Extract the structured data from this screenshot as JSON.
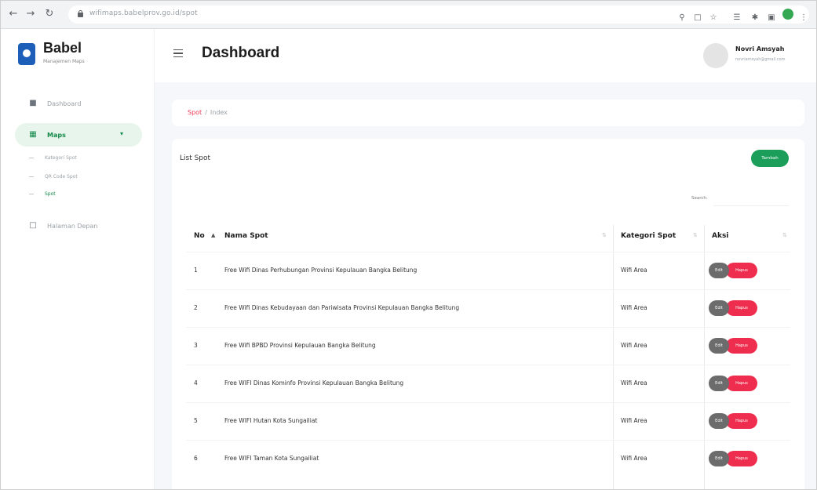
{
  "browser": {
    "url": "wifimaps.babelprov.go.id/spot",
    "back_icon": "arrow-left-icon",
    "forward_icon": "arrow-right-icon",
    "reload_icon": "reload-icon"
  },
  "sidebar": {
    "brand_title": "Babel",
    "brand_sub": "Manajemen Maps",
    "items": [
      {
        "label": "Dashboard",
        "icon": "dashboard-icon"
      },
      {
        "label": "Maps",
        "icon": "map-icon",
        "active": true
      },
      {
        "label": "Halaman Depan",
        "icon": "monitor-icon"
      }
    ],
    "submenu": [
      {
        "label": "Kategori Spot"
      },
      {
        "label": "QR Code Spot"
      },
      {
        "label": "Spot",
        "current": true
      }
    ]
  },
  "header": {
    "title": "Dashboard",
    "user_name": "Novri Amsyah",
    "user_email": "novriamsyah@gmail.com"
  },
  "breadcrumb": {
    "link": "Spot",
    "separator": "/",
    "current": "Index"
  },
  "list": {
    "title": "List Spot",
    "add_label": "Tambah",
    "search_label": "Search:",
    "search_value": "",
    "columns": [
      "No",
      "Nama Spot",
      "Kategori Spot",
      "Aksi"
    ],
    "edit_label": "Edit",
    "delete_label": "Hapus",
    "rows": [
      {
        "no": "1",
        "name": "Free Wifi Dinas Perhubungan Provinsi Kepulauan Bangka Belitung",
        "category": "Wifi Area"
      },
      {
        "no": "2",
        "name": "Free Wifi Dinas Kebudayaan dan Pariwisata Provinsi Kepulauan Bangka Belitung",
        "category": "Wifi Area"
      },
      {
        "no": "3",
        "name": "Free Wifi BPBD Provinsi Kepulauan Bangka Belitung",
        "category": "Wifi Area"
      },
      {
        "no": "4",
        "name": "Free WIFI Dinas Kominfo Provinsi Kepulauan Bangka Belitung",
        "category": "Wifi Area"
      },
      {
        "no": "5",
        "name": "Free WIFI Hutan Kota Sungailiat",
        "category": "Wifi Area"
      },
      {
        "no": "6",
        "name": "Free WIFI Taman Kota Sungailiat",
        "category": "Wifi Area"
      }
    ]
  },
  "colors": {
    "accent_green": "#1a9e5a",
    "danger": "#ef2d4f",
    "breadcrumb_link": "#ef3b56"
  }
}
